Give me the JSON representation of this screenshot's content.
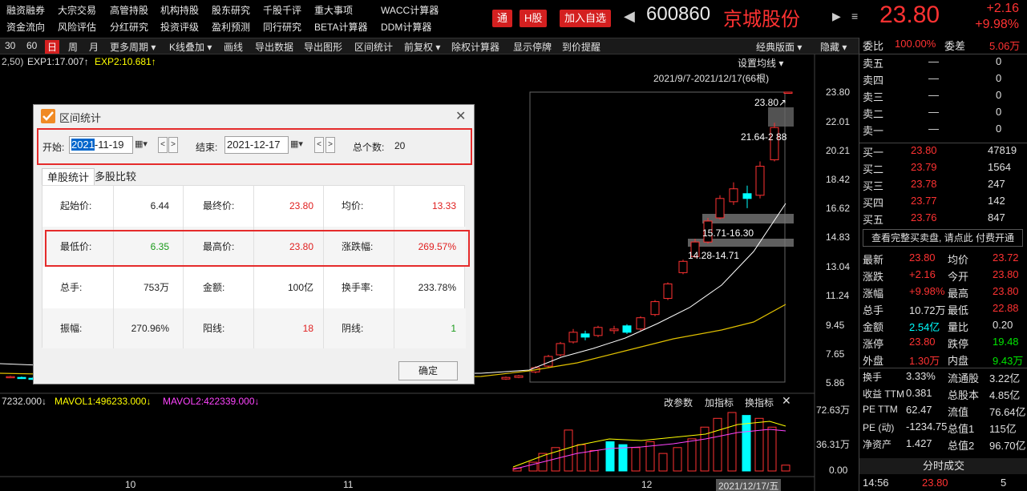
{
  "top_menu": {
    "row1": [
      "融资融券",
      "大宗交易",
      "高管持股",
      "机构持股",
      "股东研究",
      "千股千评",
      "重大事项",
      "WACC计算器"
    ],
    "row2": [
      "资金流向",
      "风险评估",
      "分红研究",
      "投资评级",
      "盈利预测",
      "同行研究",
      "BETA计算器",
      "DDM计算器"
    ]
  },
  "header": {
    "tong_label": "通",
    "h_share_label": "H股",
    "add_watch_label": "加入自选",
    "code": "600860",
    "name": "京城股份",
    "price": "23.80",
    "change": "+2.16",
    "change_pct": "+9.98%"
  },
  "toolbar": {
    "items": [
      "30",
      "60",
      "日",
      "周",
      "月",
      "更多周期 ▾",
      "K线叠加 ▾",
      "画线",
      "导出数据",
      "导出图形",
      "区间统计",
      "前复权 ▾",
      "除权计算器",
      "显示停牌",
      "到价提醒"
    ],
    "active": "日",
    "right_items": [
      "经典版面 ▾",
      "隐藏 ▾"
    ]
  },
  "chart": {
    "ind_prefix": "2,50)",
    "exp1": "EXP1:17.007↑",
    "exp2": "EXP2:10.681↑",
    "set_ma_label": "设置均线 ▾",
    "range_label": "2021/9/7-2021/12/17(66根)",
    "marker_high": "23.80↗",
    "marker_mid": "21.64-2  88",
    "marker_zone1": "15.71-16.30",
    "marker_zone2": "14.28-14.71",
    "y_ticks": [
      "23.80",
      "22.01",
      "20.21",
      "18.42",
      "16.62",
      "14.83",
      "13.04",
      "11.24",
      "9.45",
      "7.65",
      "5.86"
    ],
    "vol_line": "7232.000↓",
    "mavol1": "MAVOL1:496233.000↓",
    "mavol2": "MAVOL2:422339.000↓",
    "vol_buttons": [
      "改参数",
      "加指标",
      "换指标"
    ],
    "vol_y_ticks": [
      "72.63万",
      "36.31万",
      "0.00"
    ],
    "x_labels": [
      "10",
      "11",
      "12",
      "2021/12/17/五"
    ]
  },
  "chart_data": {
    "type": "candlestick",
    "range": "2021/9/7-2021/12/17",
    "bars": 66,
    "ylim": [
      5.86,
      23.8
    ]
  },
  "dialog": {
    "title": "区间统计",
    "start_label": "开始:",
    "start_sel": "2021",
    "start_rest": "-11-19",
    "end_label": "结束:",
    "end_value": "2021-12-17",
    "count_label": "总个数:",
    "count_value": "20",
    "tab_single": "单股统计",
    "tab_multi": "多股比较",
    "rows": [
      [
        [
          "起始价:",
          "6.44",
          "white"
        ],
        [
          "最终价:",
          "23.80",
          "red"
        ],
        [
          "均价:",
          "13.33",
          "red"
        ]
      ],
      [
        [
          "最低价:",
          "6.35",
          "green"
        ],
        [
          "最高价:",
          "23.80",
          "red"
        ],
        [
          "涨跌幅:",
          "269.57%",
          "red"
        ]
      ],
      [
        [
          "总手:",
          "753万",
          "white"
        ],
        [
          "金额:",
          "100亿",
          "white"
        ],
        [
          "换手率:",
          "233.78%",
          "white"
        ]
      ],
      [
        [
          "振幅:",
          "270.96%",
          "white"
        ],
        [
          "阳线:",
          "18",
          "red"
        ],
        [
          "阴线:",
          "1",
          "green"
        ]
      ]
    ],
    "ok_label": "确定"
  },
  "right_panel": {
    "weibi_label": "委比",
    "weibi": "100.00%",
    "weicha_label": "委差",
    "weicha": "5.06万",
    "asks": [
      [
        "卖五",
        "—",
        "0"
      ],
      [
        "卖四",
        "—",
        "0"
      ],
      [
        "卖三",
        "—",
        "0"
      ],
      [
        "卖二",
        "—",
        "0"
      ],
      [
        "卖一",
        "—",
        "0"
      ]
    ],
    "bids": [
      [
        "买一",
        "23.80",
        "47819"
      ],
      [
        "买二",
        "23.79",
        "1564"
      ],
      [
        "买三",
        "23.78",
        "247"
      ],
      [
        "买四",
        "23.77",
        "142"
      ],
      [
        "买五",
        "23.76",
        "847"
      ]
    ],
    "depth_link": "查看完整买卖盘, 请点此",
    "depth_pay": "付费开通",
    "quotes": [
      [
        "最新",
        "23.80",
        "red",
        "均价",
        "23.72",
        "red"
      ],
      [
        "涨跌",
        "+2.16",
        "red",
        "今开",
        "23.80",
        "red"
      ],
      [
        "涨幅",
        "+9.98%",
        "red",
        "最高",
        "23.80",
        "red"
      ],
      [
        "总手",
        "10.72万",
        "white",
        "最低",
        "22.88",
        "red"
      ],
      [
        "金额",
        "2.54亿",
        "cyan",
        "量比",
        "0.20",
        "white"
      ],
      [
        "涨停",
        "23.80",
        "red",
        "跌停",
        "19.48",
        "green"
      ],
      [
        "外盘",
        "1.30万",
        "red",
        "内盘",
        "9.43万",
        "green"
      ]
    ],
    "fundamentals": [
      [
        "换手",
        "3.33%",
        "流通股",
        "3.22亿"
      ],
      [
        "收益 TTM",
        "0.381",
        "总股本",
        "4.85亿"
      ],
      [
        "PE TTM",
        "62.47",
        "流值",
        "76.64亿"
      ],
      [
        "PE (动)",
        "-1234.75",
        "总值1",
        "115亿"
      ],
      [
        "净资产",
        "1.427",
        "总值2",
        "96.70亿"
      ]
    ],
    "tick_title": "分时成交",
    "tick_time": "14:56",
    "tick_price": "23.80",
    "tick_vol": "5"
  },
  "colors": {
    "up": "#ff3232",
    "down": "#00ffff",
    "highlight": "#e52b2b"
  }
}
